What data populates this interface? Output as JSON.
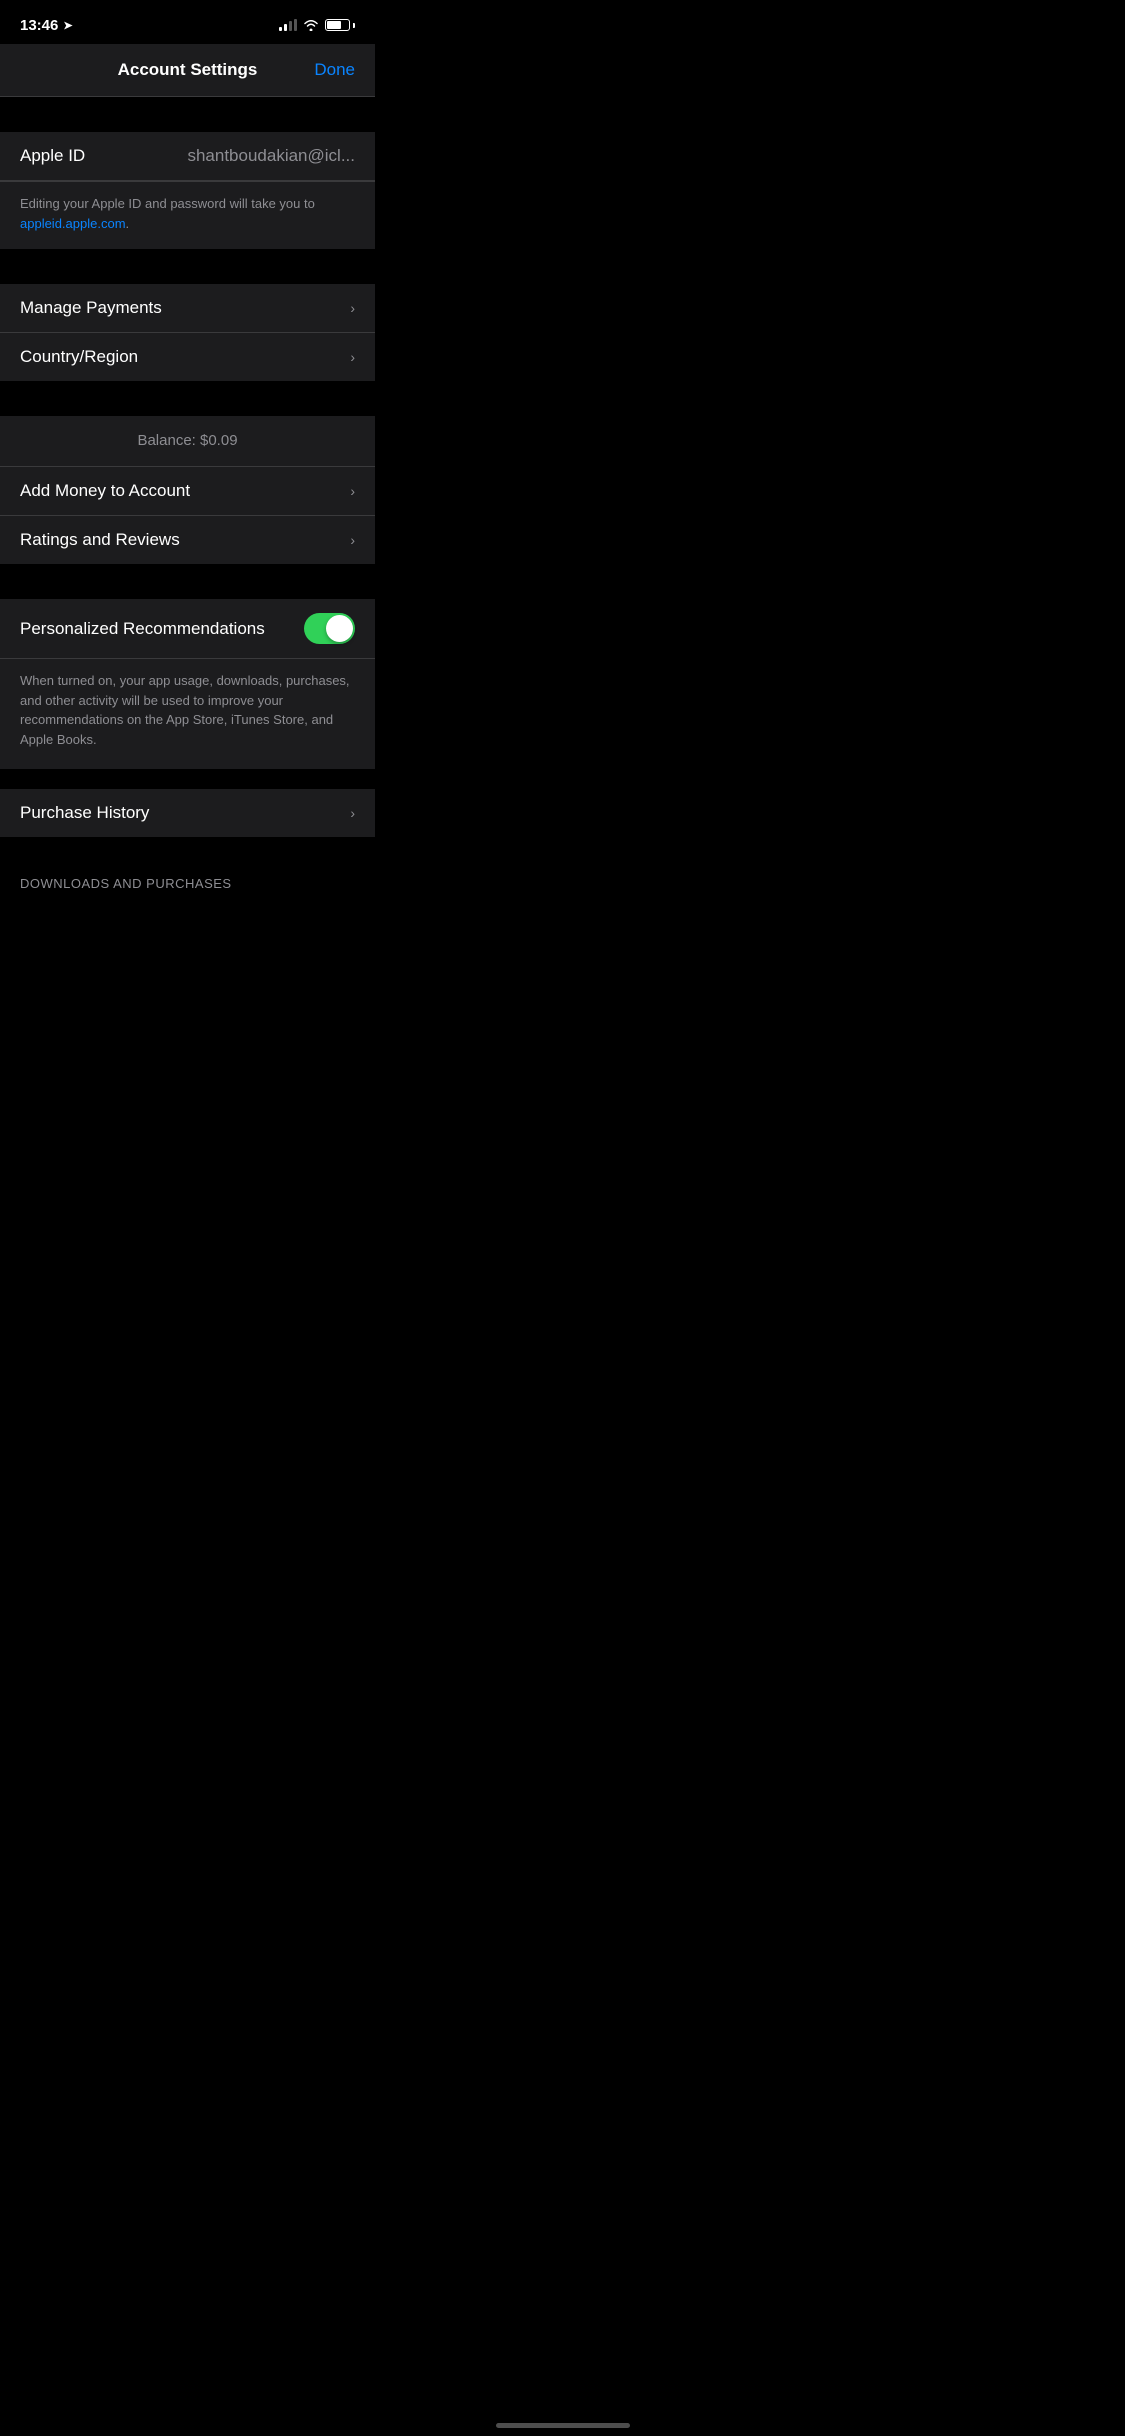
{
  "status_bar": {
    "time": "13:46",
    "location_icon": "▷"
  },
  "nav": {
    "title": "Account Settings",
    "done_label": "Done"
  },
  "apple_id": {
    "label": "Apple ID",
    "value": "shantboudakian@icl...",
    "info_text_1": "Editing your Apple ID and password will take you to ",
    "info_link": "appleid.apple.com",
    "info_text_2": "."
  },
  "payments": {
    "label": "Manage Payments"
  },
  "country": {
    "label": "Country/Region"
  },
  "balance": {
    "label": "Balance: $0.09"
  },
  "add_money": {
    "label": "Add Money to Account"
  },
  "ratings": {
    "label": "Ratings and Reviews"
  },
  "personalized": {
    "label": "Personalized Recommendations",
    "description": "When turned on, your app usage, downloads, purchases, and other activity will be used to improve your recommendations on the App Store, iTunes Store, and Apple Books.",
    "enabled": true
  },
  "purchase_history": {
    "label": "Purchase History"
  },
  "downloads_header": {
    "label": "DOWNLOADS AND PURCHASES"
  }
}
